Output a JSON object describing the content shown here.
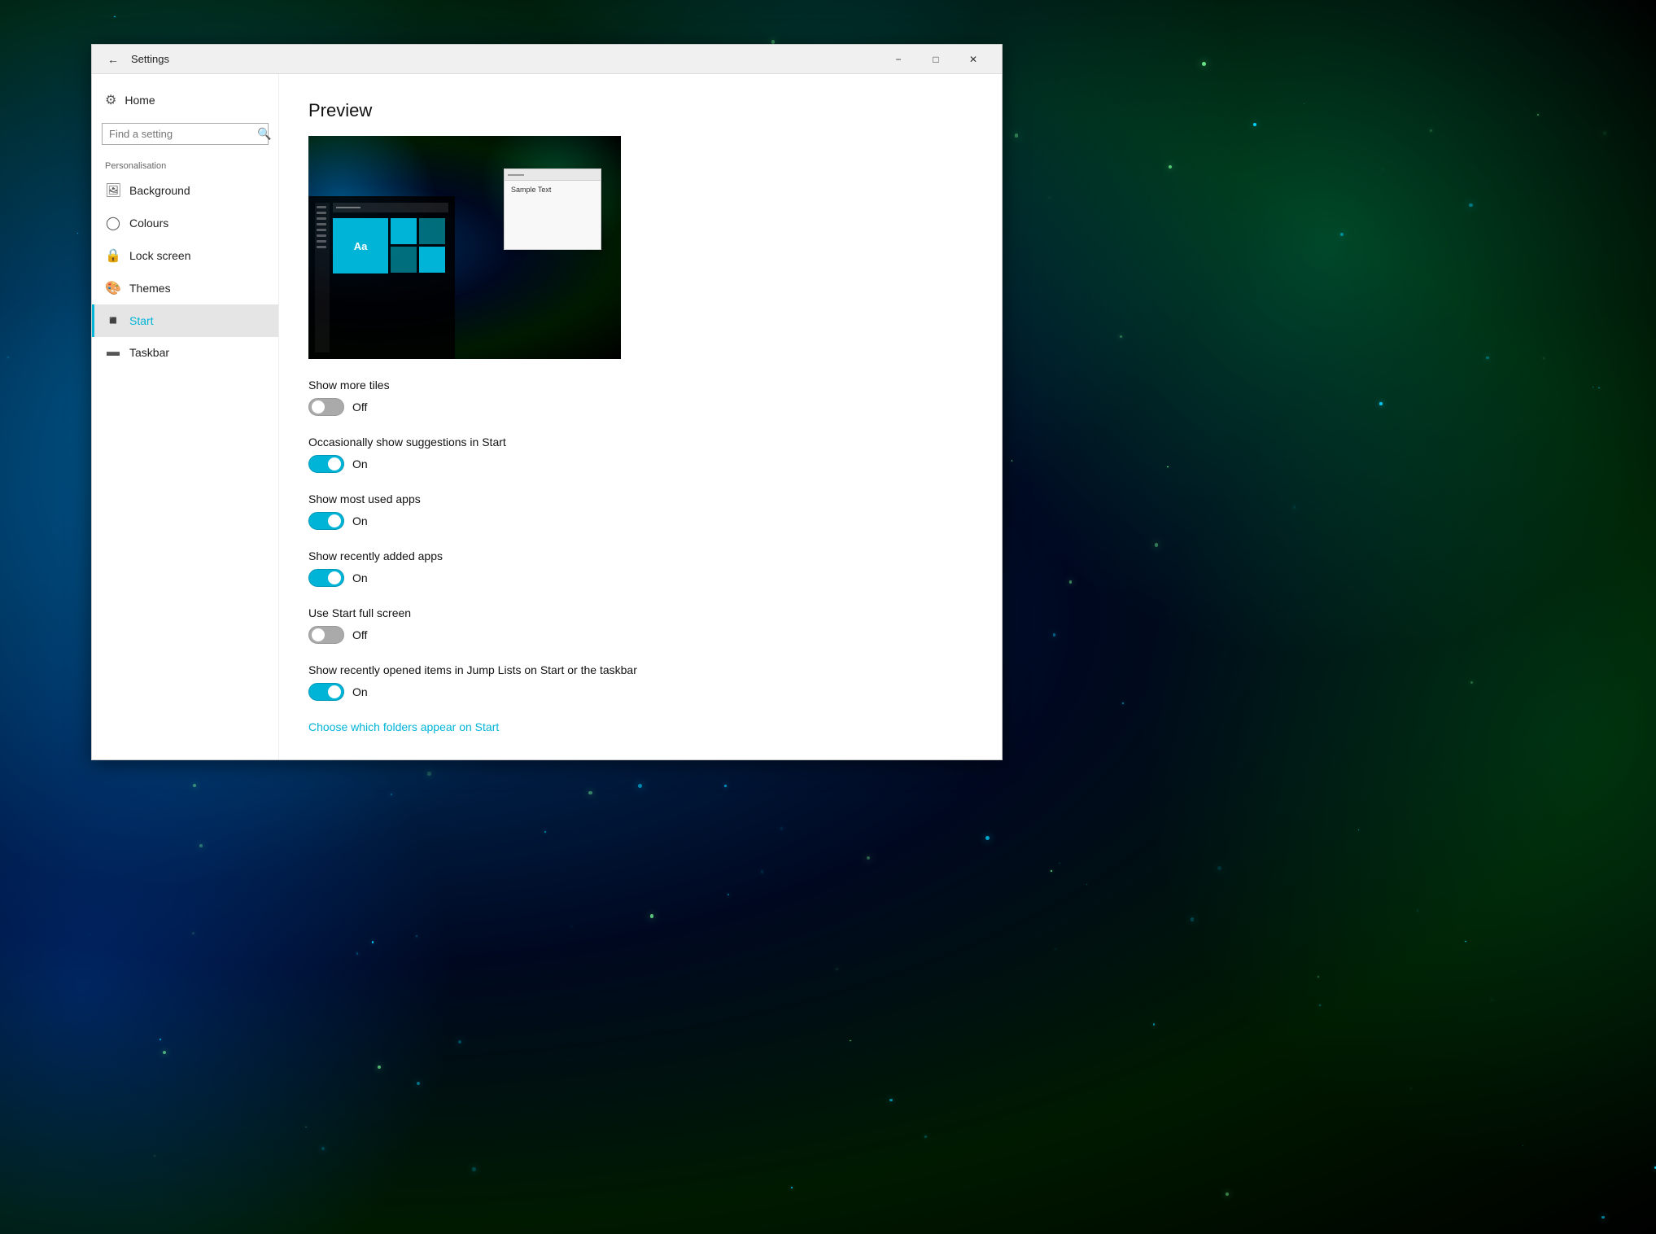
{
  "window": {
    "title": "Settings",
    "minimize_label": "−",
    "maximize_label": "□",
    "close_label": "✕"
  },
  "sidebar": {
    "home_label": "Home",
    "search_placeholder": "Find a setting",
    "section_label": "Personalisation",
    "nav_items": [
      {
        "id": "background",
        "label": "Background",
        "icon": "🖼"
      },
      {
        "id": "colours",
        "label": "Colours",
        "icon": "🎨"
      },
      {
        "id": "lock-screen",
        "label": "Lock screen",
        "icon": "🔒"
      },
      {
        "id": "themes",
        "label": "Themes",
        "icon": "🎭"
      },
      {
        "id": "start",
        "label": "Start",
        "icon": "⊞",
        "active": true
      },
      {
        "id": "taskbar",
        "label": "Taskbar",
        "icon": "📋"
      }
    ]
  },
  "content": {
    "preview_title": "Preview",
    "preview_sample_text": "Sample Text",
    "preview_tile_label": "Aa",
    "settings": [
      {
        "id": "show-more-tiles",
        "label": "Show more tiles",
        "state": "off",
        "state_label": "Off"
      },
      {
        "id": "suggestions",
        "label": "Occasionally show suggestions in Start",
        "state": "on",
        "state_label": "On"
      },
      {
        "id": "most-used",
        "label": "Show most used apps",
        "state": "on",
        "state_label": "On"
      },
      {
        "id": "recently-added",
        "label": "Show recently added apps",
        "state": "on",
        "state_label": "On"
      },
      {
        "id": "full-screen",
        "label": "Use Start full screen",
        "state": "off",
        "state_label": "Off"
      },
      {
        "id": "jump-lists",
        "label": "Show recently opened items in Jump Lists on Start or the taskbar",
        "state": "on",
        "state_label": "On"
      }
    ],
    "folders_link": "Choose which folders appear on Start"
  }
}
